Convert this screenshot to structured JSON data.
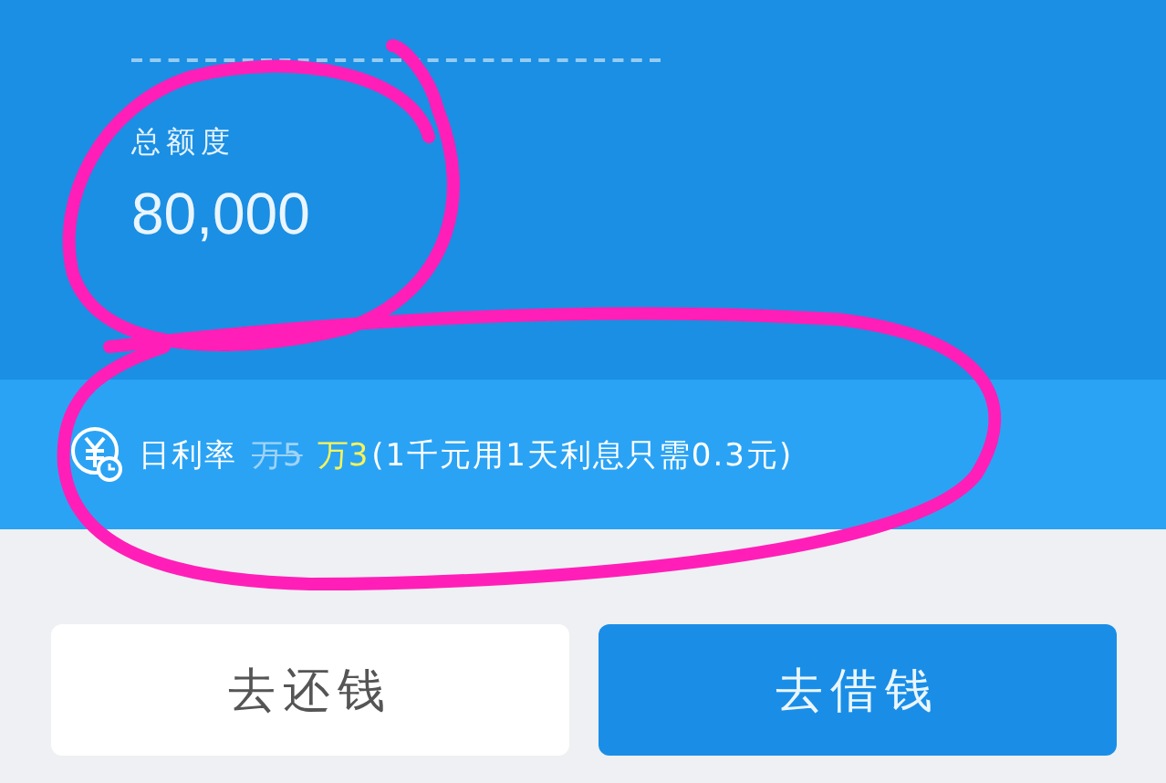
{
  "credit": {
    "label": "总额度",
    "amount": "80,000"
  },
  "rate": {
    "label": "日利率",
    "old_rate": "万5",
    "new_rate": "万3",
    "note": "(1千元用1天利息只需0.3元)"
  },
  "buttons": [
    {
      "label": "去还钱",
      "kind": "secondary"
    },
    {
      "label": "去借钱",
      "kind": "primary"
    }
  ]
}
